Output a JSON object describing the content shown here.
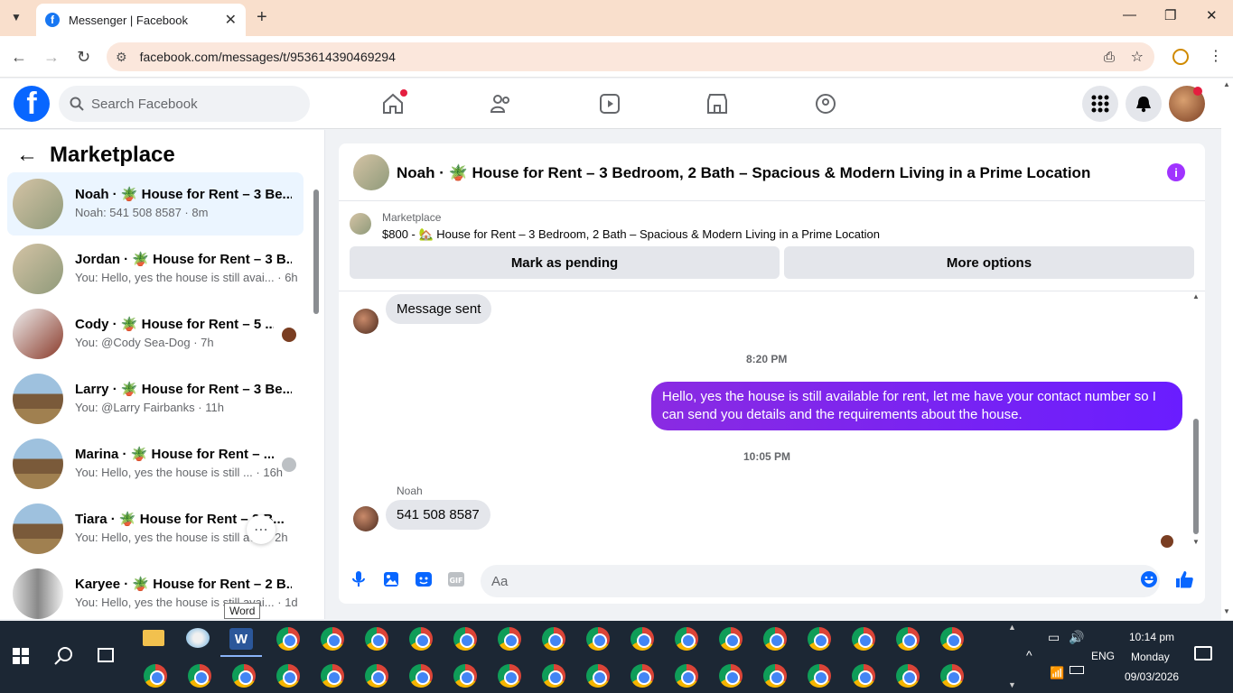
{
  "browser": {
    "tab_title": "Messenger | Facebook",
    "url": "facebook.com/messages/t/953614390469294"
  },
  "fb": {
    "search_placeholder": "Search Facebook"
  },
  "left": {
    "title": "Marketplace",
    "conversations": [
      {
        "name": "Noah · 🪴 House for Rent – 3 Be...",
        "sub": "Noah: 541 508 8587 · 8m"
      },
      {
        "name": "Jordan · 🪴 House for Rent – 3 B...",
        "sub": "You: Hello, yes the house is still avai... · 6h"
      },
      {
        "name": "Cody · 🪴 House for Rent – 5 ...",
        "sub": "You: @Cody Sea-Dog · 7h"
      },
      {
        "name": "Larry · 🪴 House for Rent – 3 Be...",
        "sub": "You: @Larry Fairbanks · 11h"
      },
      {
        "name": "Marina · 🪴 House for Rent – ...",
        "sub": "You: Hello, yes the house is still ... · 16h"
      },
      {
        "name": "Tiara · 🪴 House for Rent – 3 B...",
        "sub": "You: Hello, yes the house is still av... · 2h"
      },
      {
        "name": "Karyee · 🪴 House for Rent – 2 B...",
        "sub": "You: Hello, yes the house is still avai... · 1d"
      }
    ]
  },
  "chat": {
    "header_title": "Noah · 🪴 House for Rent – 3 Bedroom, 2 Bath – Spacious & Modern Living in a Prime Location",
    "listing_label": "Marketplace",
    "listing_text": "$800 - 🏡 House for Rent – 3 Bedroom, 2 Bath – Spacious & Modern Living in a Prime Location",
    "mark_pending": "Mark as pending",
    "more_options": "More options",
    "msg1": "Message sent",
    "time1": "8:20 PM",
    "msg2": "Hello, yes the house is still available for rent, let me have your contact number so I can send you details and the requirements about the house.",
    "time2": "10:05 PM",
    "sender": "Noah",
    "msg3": "541 508 8587",
    "input_placeholder": "Aa"
  },
  "tooltip": "Word",
  "taskbar": {
    "time": "10:14 pm",
    "day": "Monday",
    "date": "09/03/2026",
    "lang": "ENG"
  }
}
